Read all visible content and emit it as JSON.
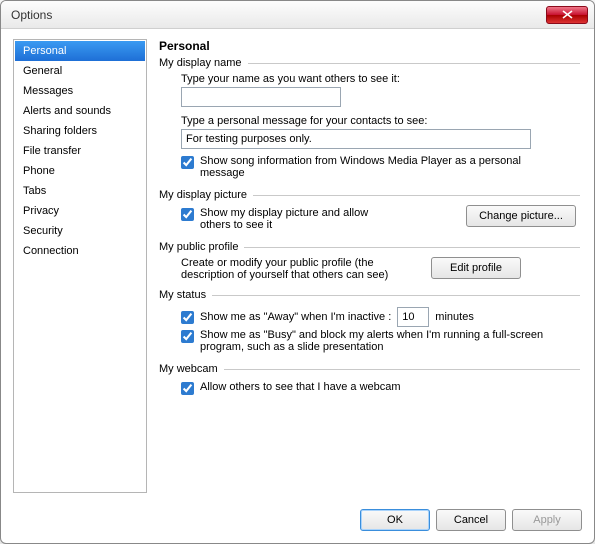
{
  "window": {
    "title": "Options"
  },
  "sidebar": {
    "items": [
      {
        "label": "Personal",
        "selected": true
      },
      {
        "label": "General"
      },
      {
        "label": "Messages"
      },
      {
        "label": "Alerts and sounds"
      },
      {
        "label": "Sharing folders"
      },
      {
        "label": "File transfer"
      },
      {
        "label": "Phone"
      },
      {
        "label": "Tabs"
      },
      {
        "label": "Privacy"
      },
      {
        "label": "Security"
      },
      {
        "label": "Connection"
      }
    ]
  },
  "content": {
    "heading": "Personal",
    "displayName": {
      "group_label": "My display name",
      "name_prompt": "Type your name as you want others to see it:",
      "name_value": "",
      "message_prompt": "Type a personal message for your contacts to see:",
      "message_value": "For testing purposes only.",
      "song_checkbox_label": "Show song information from Windows Media Player as a personal message",
      "song_checked": true
    },
    "displayPicture": {
      "group_label": "My display picture",
      "show_label": "Show my display picture and allow others to see it",
      "show_checked": true,
      "change_button": "Change picture..."
    },
    "publicProfile": {
      "group_label": "My public profile",
      "description": "Create or modify your public profile (the description of yourself that others can see)",
      "edit_button": "Edit profile"
    },
    "status": {
      "group_label": "My status",
      "away_prefix": "Show me as \"Away\" when I'm inactive :",
      "away_minutes": "10",
      "away_suffix": "minutes",
      "away_checked": true,
      "busy_label": "Show me as \"Busy\" and block my alerts when I'm running a full-screen program, such as a slide presentation",
      "busy_checked": true
    },
    "webcam": {
      "group_label": "My webcam",
      "allow_label": "Allow others to see that I have a webcam",
      "allow_checked": true
    }
  },
  "footer": {
    "ok": "OK",
    "cancel": "Cancel",
    "apply": "Apply"
  }
}
